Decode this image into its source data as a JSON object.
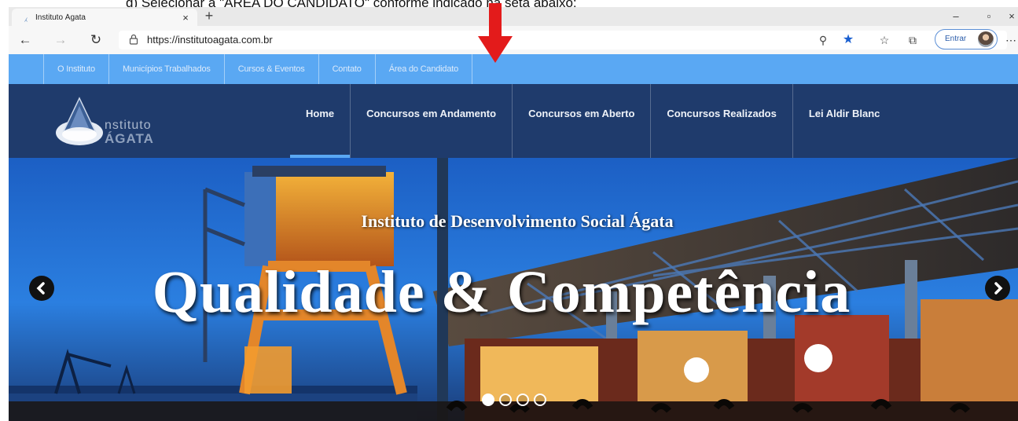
{
  "instruction": {
    "text": "d) Selecionar a \"ÁREA DO CANDIDATO\" conforme indicado na seta abaixo:"
  },
  "browser": {
    "tab": {
      "title": "Instituto Ágata",
      "favicon": "agata-favicon-icon"
    },
    "url": "https://institutoagata.com.br",
    "signin_label": "Entrar",
    "icons": [
      "back-arrow-icon",
      "forward-arrow-icon",
      "refresh-icon",
      "lock-icon",
      "zoom-icon",
      "favorite-star-icon",
      "favorites-icon",
      "collections-icon",
      "more-icon"
    ]
  },
  "site": {
    "topnav": [
      {
        "label": "O Instituto"
      },
      {
        "label": "Municípios Trabalhados"
      },
      {
        "label": "Cursos & Eventos"
      },
      {
        "label": "Contato"
      },
      {
        "label": "Área do Candidato"
      }
    ],
    "logo": {
      "line1": "nstituto",
      "line2": "ÁGATA"
    },
    "mainnav": [
      {
        "label": "Home",
        "active": true
      },
      {
        "label": "Concursos em Andamento",
        "active": false
      },
      {
        "label": "Concursos em Aberto",
        "active": false
      },
      {
        "label": "Concursos Realizados",
        "active": false
      },
      {
        "label": "Lei Aldir Blanc",
        "active": false
      }
    ],
    "hero": {
      "subtitle": "Instituto de Desenvolvimento Social Ágata",
      "title": "Qualidade & Competência",
      "slide_count": 4,
      "active_slide": 1
    }
  },
  "colors": {
    "topnav_bg": "#5aa8f3",
    "header_bg": "#1f3b6c",
    "annotation_arrow": "#e31b1b"
  }
}
